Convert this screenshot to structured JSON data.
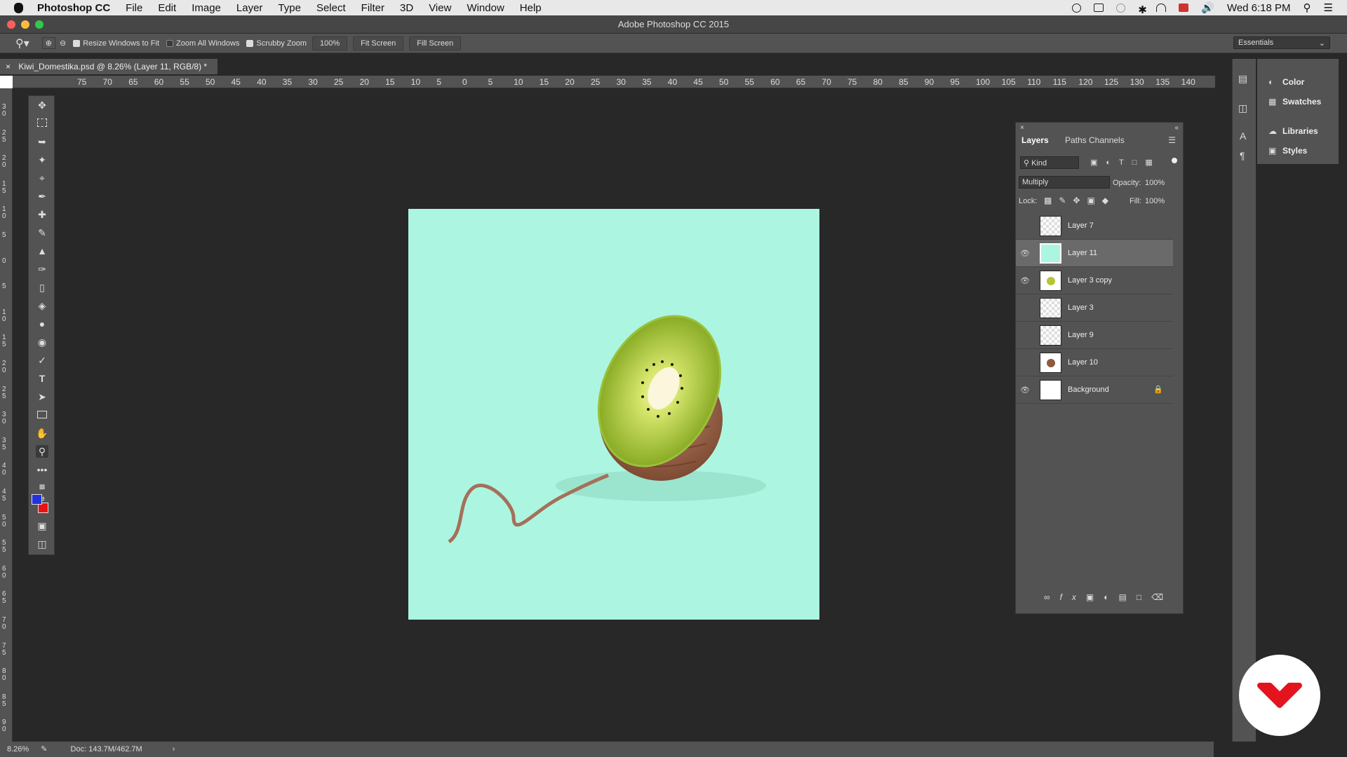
{
  "menubar": {
    "app": "Photoshop CC",
    "items": [
      "File",
      "Edit",
      "Image",
      "Layer",
      "Type",
      "Select",
      "Filter",
      "3D",
      "View",
      "Window",
      "Help"
    ],
    "clock": "Wed 6:18 PM"
  },
  "window": {
    "title": "Adobe Photoshop CC 2015"
  },
  "options": {
    "resize_windows": "Resize Windows to Fit",
    "zoom_all": "Zoom All Windows",
    "scrubby": "Scrubby Zoom",
    "zoom_value": "100%",
    "fit_screen": "Fit Screen",
    "fill_screen": "Fill Screen",
    "workspace": "Essentials"
  },
  "document": {
    "tab_title": "Kiwi_Domestika.psd @ 8.26% (Layer 11, RGB/8) *"
  },
  "ruler_labels": [
    "75",
    "70",
    "65",
    "60",
    "55",
    "50",
    "45",
    "40",
    "35",
    "30",
    "25",
    "20",
    "15",
    "10",
    "5",
    "0",
    "5",
    "10",
    "15",
    "20",
    "25",
    "30",
    "35",
    "40",
    "45",
    "50",
    "55",
    "60",
    "65",
    "70",
    "75",
    "80",
    "85",
    "90",
    "95",
    "100",
    "105",
    "110",
    "115",
    "120",
    "125",
    "130",
    "135",
    "140"
  ],
  "ruler_v_labels": [
    "3 0",
    "2 5",
    "2 0",
    "1 5",
    "1 0",
    "5",
    "0",
    "5",
    "1 0",
    "1 5",
    "2 0",
    "2 5",
    "3 0",
    "3 5",
    "4 0",
    "4 5",
    "5 0",
    "5 5",
    "6 0",
    "6 5",
    "7 0",
    "7 5",
    "8 0",
    "8 5",
    "9 0"
  ],
  "layers_panel": {
    "tabs": [
      "Layers",
      "Paths",
      "Channels"
    ],
    "filter": "Kind",
    "blend_mode": "Multiply",
    "opacity_label": "Opacity:",
    "opacity": "100%",
    "lock_label": "Lock:",
    "fill_label": "Fill:",
    "fill": "100%",
    "layers": [
      {
        "name": "Layer 7",
        "visible": false
      },
      {
        "name": "Layer 11",
        "visible": true,
        "selected": true
      },
      {
        "name": "Layer 3 copy",
        "visible": true
      },
      {
        "name": "Layer 3",
        "visible": false
      },
      {
        "name": "Layer 9",
        "visible": false
      },
      {
        "name": "Layer 10",
        "visible": false
      },
      {
        "name": "Background",
        "visible": true,
        "locked": true
      }
    ]
  },
  "right_panels": [
    "Color",
    "Swatches",
    "Libraries",
    "Styles"
  ],
  "status": {
    "zoom": "8.26%",
    "doc": "Doc: 143.7M/462.7M"
  },
  "colors": {
    "canvas_bg": "#acf6e1",
    "foreground": "#2233dd",
    "background": "#ee1111",
    "brand": "#e3141e"
  }
}
